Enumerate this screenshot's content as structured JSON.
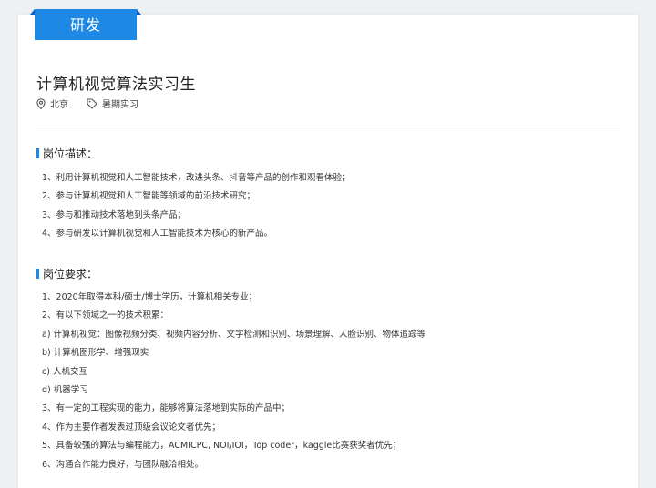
{
  "job": {
    "department": "研发",
    "title": "计算机视觉算法实习生",
    "location": "北京",
    "type": "暑期实习"
  },
  "description": {
    "heading": "岗位描述：",
    "items": [
      "1、利用计算机视觉和人工智能技术，改进头条、抖音等产品的创作和观看体验；",
      "2、参与计算机视觉和人工智能等领域的前沿技术研究；",
      "3、参与和推动技术落地到头条产品；",
      "4、参与研发以计算机视觉和人工智能技术为核心的新产品。"
    ]
  },
  "requirements": {
    "heading": "岗位要求：",
    "items": [
      "1、2020年取得本科/硕士/博士学历，计算机相关专业；",
      "2、有以下领域之一的技术积累：",
      "a) 计算机视觉：图像视频分类、视频内容分析、文字检测和识别、场景理解、人脸识别、物体追踪等",
      "b) 计算机图形学、增强现实",
      "c) 人机交互",
      "d) 机器学习",
      "3、有一定的工程实现的能力，能够将算法落地到实际的产品中；",
      "4、作为主要作者发表过顶级会议论文者优先；",
      "5、具备较强的算法与编程能力，ACMICPC, NOI/IOI，Top coder，kaggle比赛获奖者优先；",
      "6、沟通合作能力良好，与团队融洽相处。"
    ]
  },
  "colors": {
    "accent": "#1e88e5",
    "accent_dark": "#0b5fc4"
  },
  "icons": {
    "location": "location-pin-icon",
    "type": "tag-icon"
  }
}
